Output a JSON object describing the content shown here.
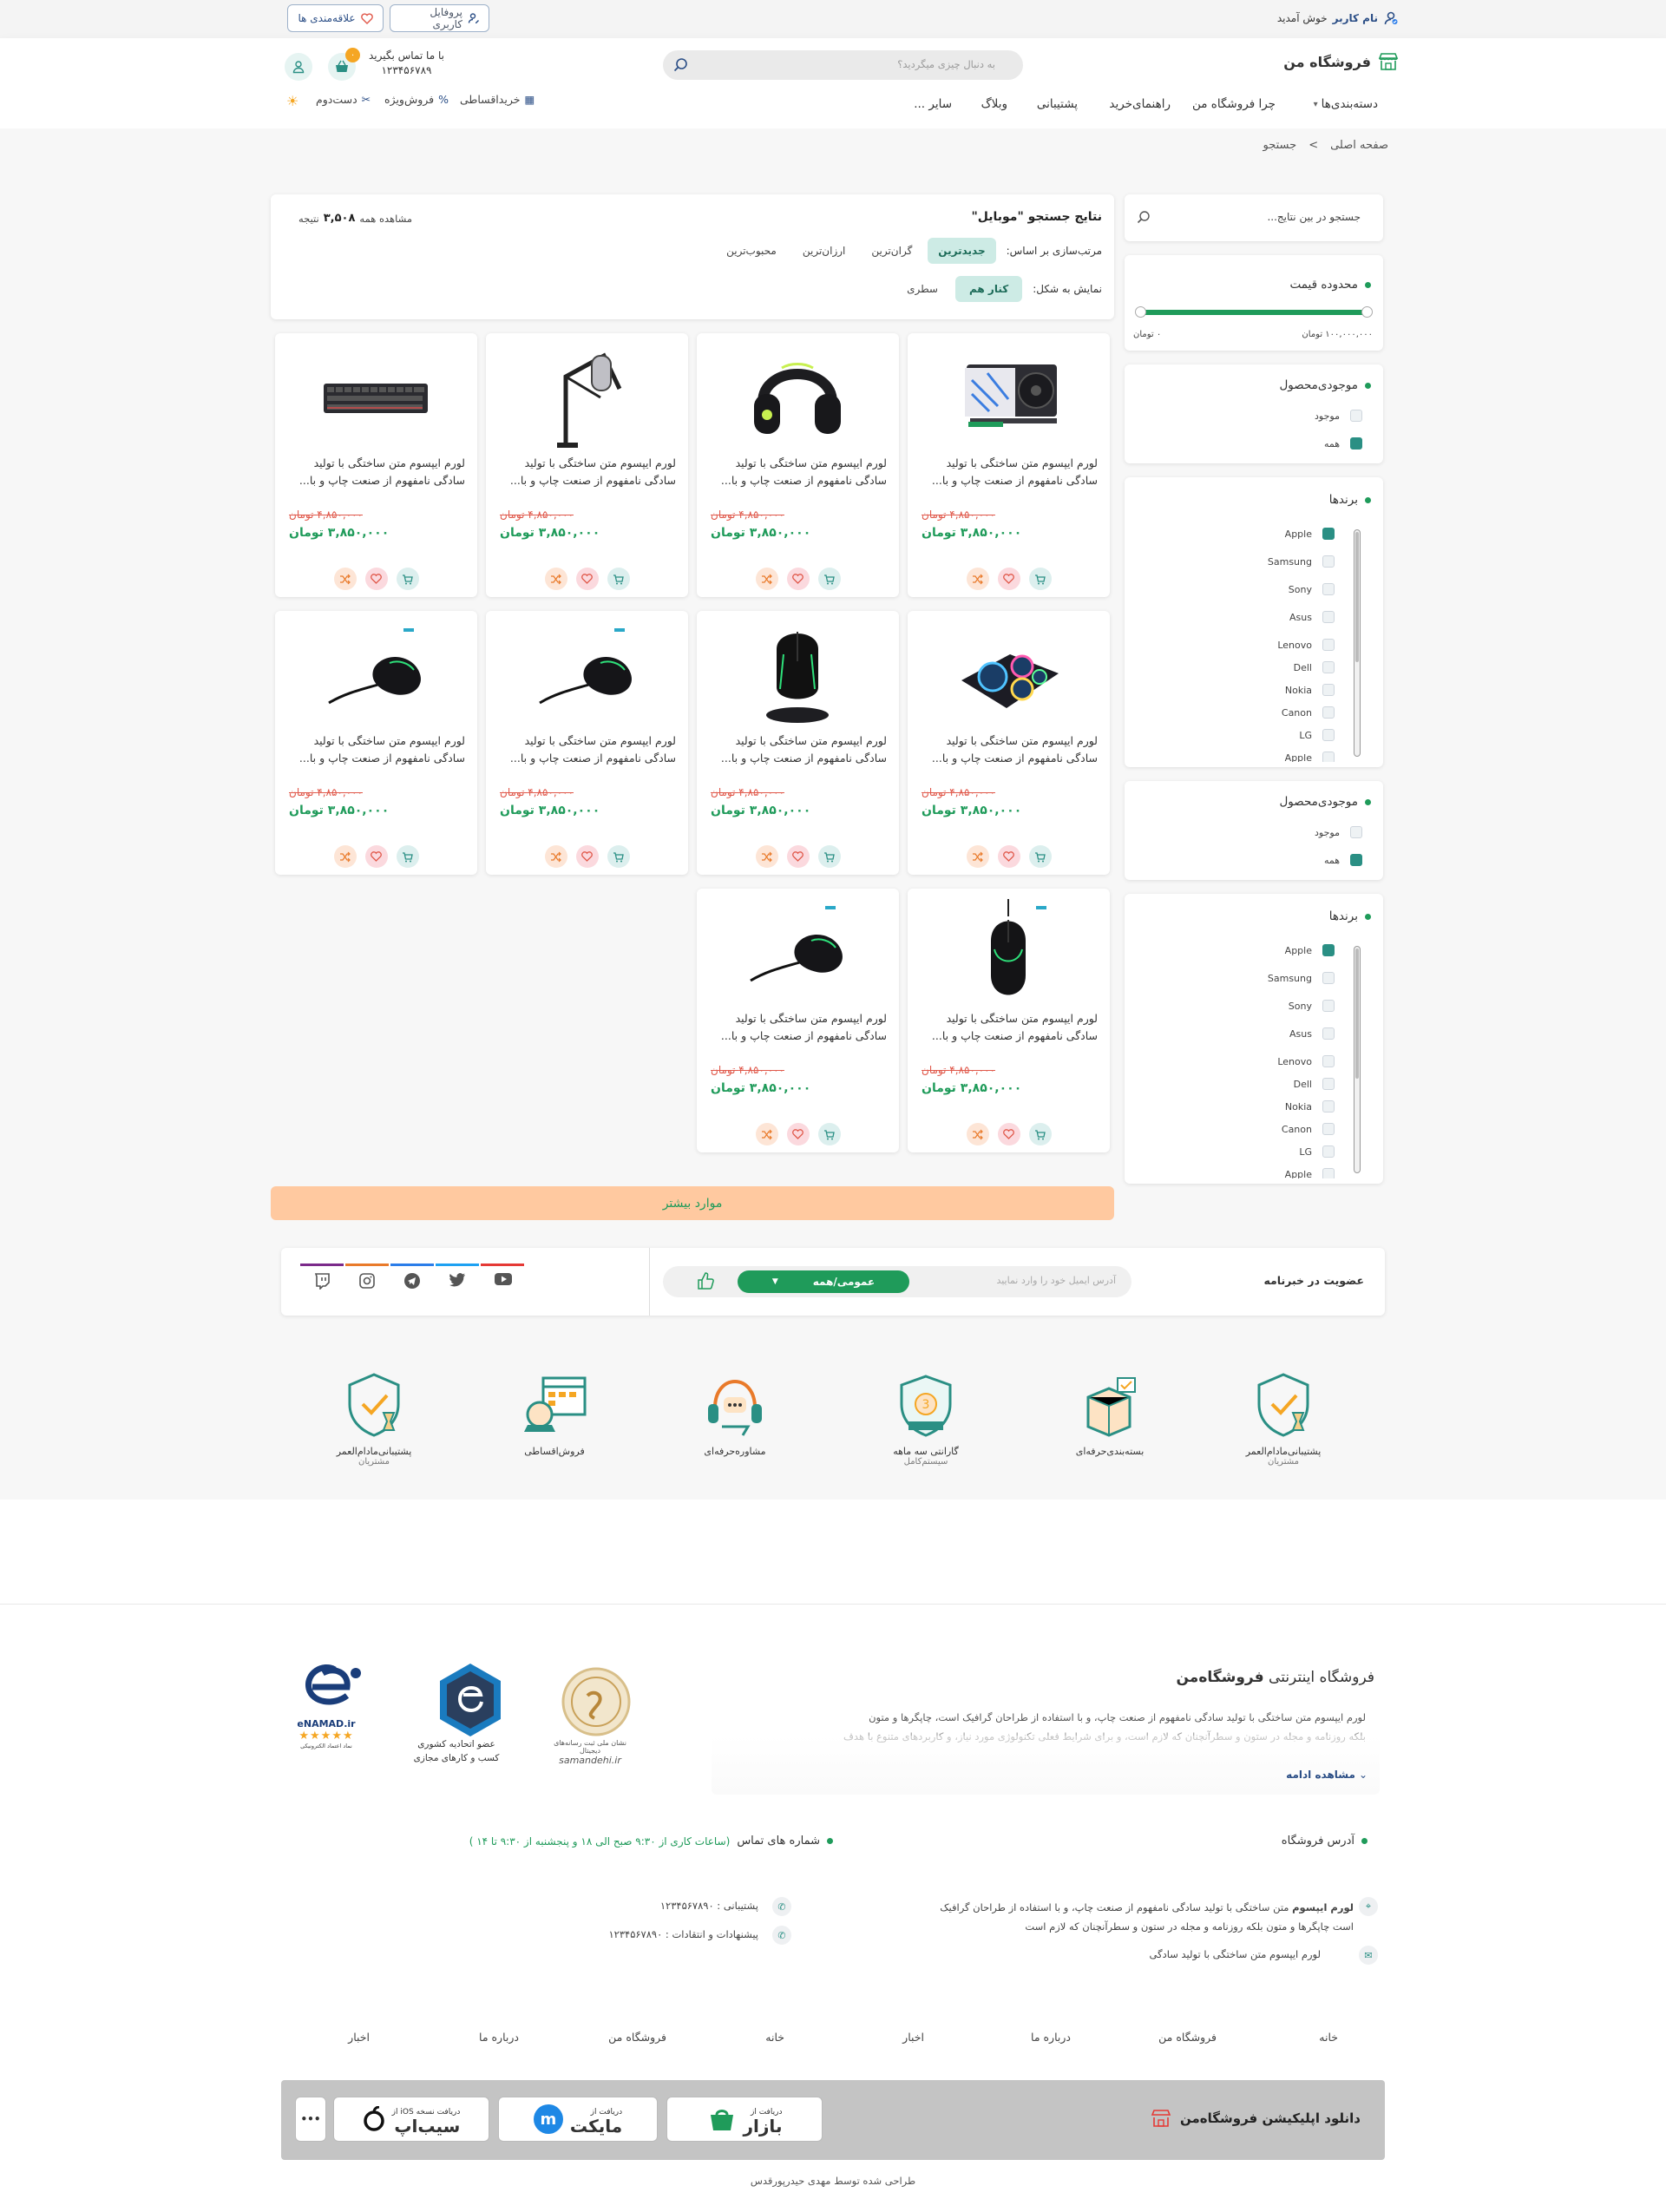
{
  "topbar": {
    "welcome_user": "نام کاربر",
    "welcome_suffix": "خوش آمدید",
    "profile_btn": "پروفایل کاربری",
    "wishlist_btn": "علاقه‌مندی ها"
  },
  "header": {
    "logo": "فروشگاه من",
    "search_placeholder": "به دنبال چیزی میگردید؟",
    "contact_label": "با ما تماس بگیرید",
    "contact_phone": "۱۲۳۴۵۶۷۸۹",
    "cart_count": "۰",
    "nav": [
      "دسته‌بندی‌ها",
      "چرا فروشگاه من",
      "راهنمای‌خرید",
      "پشتیبانی",
      "وبلاگ",
      "سایر ..."
    ],
    "subnav": [
      "خریداقساطی",
      "فروش‌ویژه",
      "دست‌دوم"
    ]
  },
  "breadcrumb": {
    "home": "صفحه اصلی",
    "sep": ">",
    "current": "جستجو"
  },
  "results": {
    "title": "نتایج جستجو \"موبایل\"",
    "count_prefix": "مشاهده همه",
    "count": "۳,۵۰۸",
    "count_suffix": "نتیجه",
    "sort_label": "مرتب‌سازی بر اساس:",
    "sort_options": [
      "جدیدترین",
      "گران‌ترین",
      "ارزان‌ترین",
      "محبوب‌ترین"
    ],
    "view_label": "نمایش به شکل:",
    "view_options": [
      "کنار هم",
      "سطری"
    ]
  },
  "sidebar": {
    "search_placeholder": "جستجو در بین نتایج...",
    "price_title": "محدوده قیمت",
    "price_max": "۱۰۰,۰۰۰,۰۰۰ تومان",
    "price_min": "۰ تومان",
    "stock_title": "موجودی‌محصول",
    "stock_options": [
      "موجود",
      "همه"
    ],
    "brands_title": "برندها",
    "brands": [
      "Apple",
      "Samsung",
      "Sony",
      "Asus",
      "Lenovo",
      "Dell",
      "Nokia",
      "Canon",
      "LG",
      "Apple"
    ]
  },
  "product": {
    "title_line1": "لورم ایپسوم متن ساختگی با تولید",
    "title_line2": "سادگی نامفهوم از صنعت چاپ و با...",
    "old_price": "۴,۸۵۰,۰۰۰ تومان",
    "new_price": "۳,۸۵۰,۰۰۰ تومان"
  },
  "products": [
    {
      "img": "graphics-card"
    },
    {
      "img": "headset"
    },
    {
      "img": "mic-arm"
    },
    {
      "img": "keyboard"
    },
    {
      "img": "cooling-pad"
    },
    {
      "img": "mouse-dock"
    },
    {
      "img": "mouse-cable"
    },
    {
      "img": "mouse-cable"
    },
    {
      "img": "mouse-tall"
    },
    {
      "img": "mouse-cable"
    }
  ],
  "load_more": "موارد بیشتر",
  "newsletter": {
    "title": "عضویت در خبرنامه",
    "placeholder": "آدرس ایمیل خود را وارد نمایید",
    "select": "عمومی/همه"
  },
  "features": [
    "پشتیبانی‌مادام‌العمر",
    "بسته‌بندی‌حرفه‌ای",
    "گارانتی سه ماهه",
    "مشاوره‌حرفه‌ای",
    "فروش‌اقساطی",
    "پشتیبانی‌مادام‌العمر"
  ],
  "features_sub": [
    "مشتریان",
    "",
    "سیستم‌کامل",
    "",
    "",
    "مشتریان"
  ],
  "footer": {
    "about_title_a": "فروشگاه اینترنتی",
    "about_title_b": "فروشگاه‌من",
    "about_text1": "لورم ایپسوم متن ساختگی با تولید سادگی نامفهوم از صنعت چاپ، و با استفاده از طراحان گرافیک است، چاپگرها و متون",
    "about_text2": "بلکه روزنامه و مجله در ستون و سطرآنچنان که لازم است، و برای شرایط فعلی تکنولوژی مورد نیاز، و کاربردهای متنوع با هدف",
    "read_more": "مشاهده ادامه",
    "address_title": "آدرس فروشگاه",
    "phones_title": "شماره های تماس",
    "phones_hours": "(ساعات کاری از ۹:۳۰ صبح الی ۱۸ و پنجشنبه از ۹:۳۰ تا ۱۴ )",
    "addr_bold": "لورم ایپسوم",
    "addr_text": "متن ساختگی با تولید سادگی نامفهوم از صنعت چاپ، و با استفاده از طراحان گرافیک",
    "addr_text2": "است چاپگرها و متون بلکه روزنامه و مجله در ستون و سطرآنچنان که لازم است",
    "postal": "لورم ایپسوم متن ساختگی با تولید سادگی",
    "support": "پشتیبانی : ۱۲۳۴۵۶۷۸۹۰",
    "suggest": "پیشنهادات و انتقادات : ۱۲۳۴۵۶۷۸۹۰",
    "links": [
      "خانه",
      "فروشگاه من",
      "درباره ما",
      "اخبار",
      "خانه",
      "فروشگاه من",
      "درباره ما",
      "اخبار"
    ],
    "badge_samandehi": "samandehi.ir",
    "badge_samandehi_sub": "نشان ملی ثبت رسانه‌های دیجیتال",
    "badge_union": "عضو اتحادیه کشوری",
    "badge_union_sub": "کسب و کارهای مجازی",
    "badge_enamad": "eNAMAD.ir",
    "badge_enamad_sub": "نماد اعتماد الکترونیکی",
    "app_title": "دانلود اپلیکیشن فروشگاه‌من",
    "app_bazaar_small": "دریافت از",
    "app_bazaar": "بازار",
    "app_myket_small": "دریافت از",
    "app_myket": "مایکت",
    "app_sibapp_small": "دریافت نسخه iOS از",
    "app_sibapp": "سیب‌اپ",
    "app_more": "•••",
    "credit": "طراحی شده توسط مهدی حیدرپورقدس"
  },
  "colors": {
    "accent": "#1f9b5a",
    "teal": "#2a8f84",
    "loadmore": "#ffc9a0",
    "navy": "#2b4e86"
  }
}
